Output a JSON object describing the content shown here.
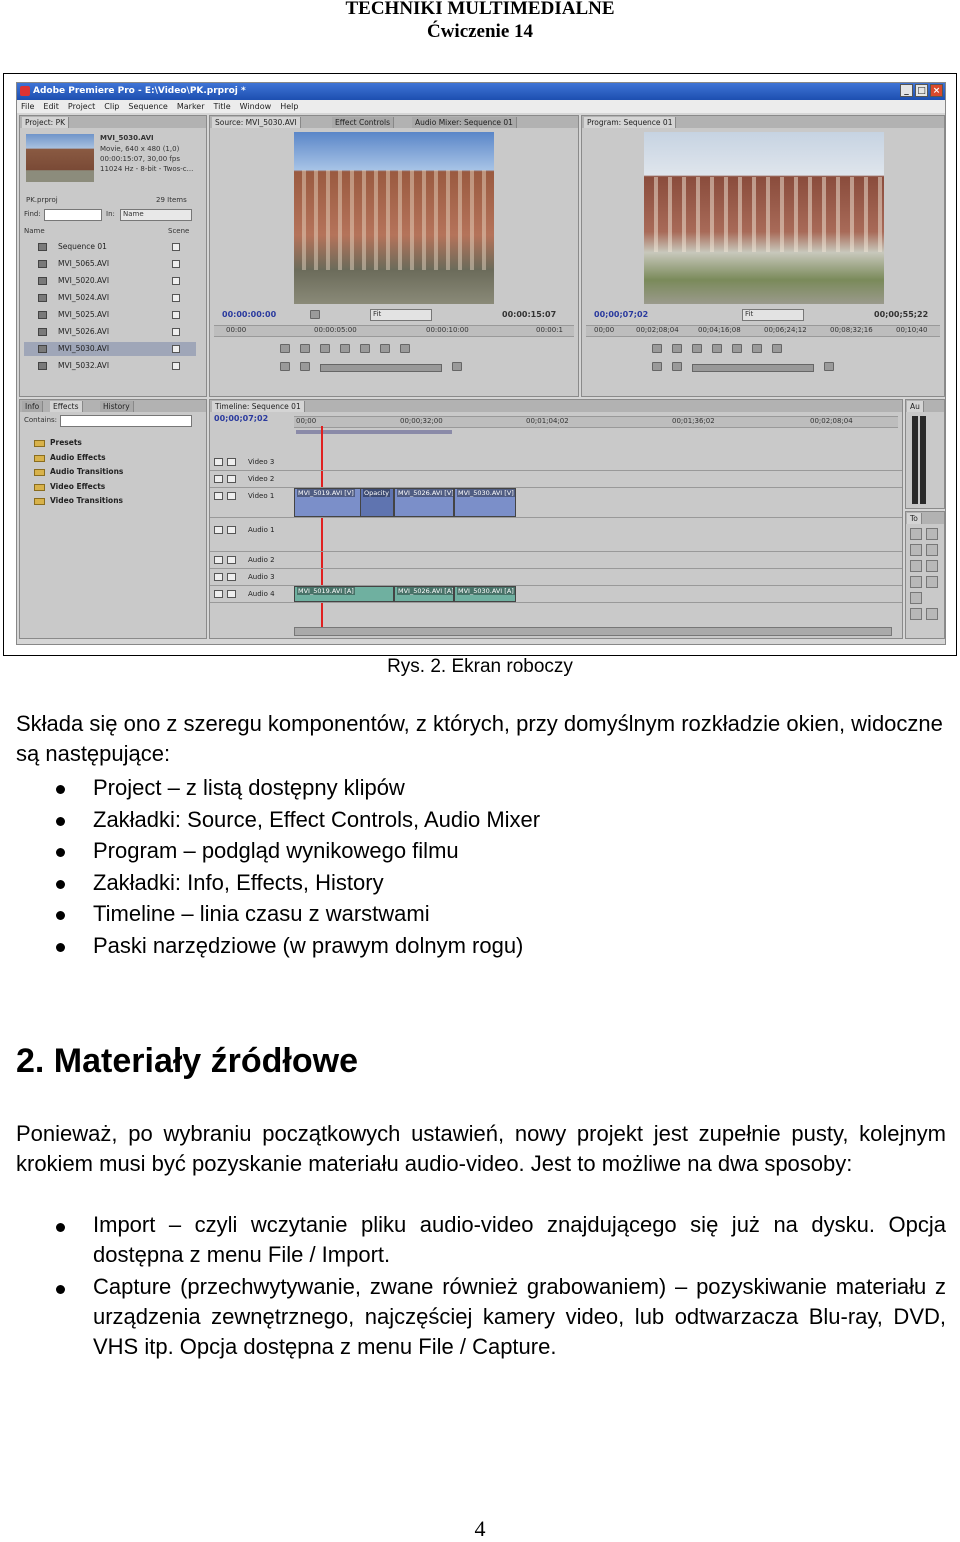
{
  "header": {
    "course": "TECHNIKI MULTIMEDIALNE",
    "exercise": "Ćwiczenie 14"
  },
  "screenshot": {
    "window_title": "Adobe Premiere Pro - E:\\Video\\PK.prproj *",
    "window_buttons": [
      "_",
      "□",
      "×"
    ],
    "menu": [
      "File",
      "Edit",
      "Project",
      "Clip",
      "Sequence",
      "Marker",
      "Title",
      "Window",
      "Help"
    ],
    "project_panel": {
      "tab": "Project: PK",
      "clip_name": "MVI_5030.AVI",
      "clip_info": [
        "Movie, 640 x 480 (1,0)",
        "00:00:15:07, 30,00 fps",
        "11024 Hz - 8-bit - Twos-c..."
      ],
      "project_file": "PK.prproj",
      "item_count": "29 Items",
      "find_label": "Find:",
      "in_label": "In:",
      "in_value": "Name",
      "col_name": "Name",
      "col_scene": "Scene",
      "items": [
        "Sequence 01",
        "MVI_5065.AVI",
        "MVI_5020.AVI",
        "MVI_5024.AVI",
        "MVI_5025.AVI",
        "MVI_5026.AVI",
        "MVI_5030.AVI",
        "MVI_5032.AVI"
      ],
      "selected_index": 6
    },
    "source_panel": {
      "tabs": [
        "Source: MVI_5030.AVI",
        "Effect Controls",
        "Audio Mixer: Sequence 01"
      ],
      "timecode_left": "00:00:00:00",
      "fit": "Fit",
      "timecode_right": "00:00:15:07",
      "ruler": [
        "00:00",
        "00:00:05:00",
        "00:00:10:00",
        "00:00:1"
      ]
    },
    "program_panel": {
      "tab": "Program: Sequence 01",
      "timecode_left": "00;00;07;02",
      "fit": "Fit",
      "timecode_right": "00;00;55;22",
      "ruler": [
        "00;00",
        "00;02;08;04",
        "00;04;16;08",
        "00;06;24;12",
        "00;08;32;16",
        "00;10;40"
      ]
    },
    "effects_panel": {
      "tabs": [
        "Info",
        "Effects",
        "History"
      ],
      "contains_label": "Contains:",
      "folders": [
        "Presets",
        "Audio Effects",
        "Audio Transitions",
        "Video Effects",
        "Video Transitions"
      ]
    },
    "timeline_panel": {
      "tab": "Timeline: Sequence 01",
      "timecode": "00;00;07;02",
      "ruler": [
        "00;00",
        "00;00;32;00",
        "00;01;04;02",
        "00;01;36;02",
        "00;02;08;04"
      ],
      "video_tracks": [
        "Video 3",
        "Video 2",
        "Video 1"
      ],
      "audio_tracks": [
        "Audio 1",
        "Audio 2",
        "Audio 3",
        "Audio 4"
      ],
      "video_clips": [
        "MVI_5019.AVI [V]",
        "Opacity",
        "MVI_5026.AVI [V]",
        "MVI_5030.AVI [V]"
      ],
      "audio_clips": [
        "MVI_5019.AVI [A]",
        "MVI_5026.AVI [A]",
        "MVI_5030.AVI [A]"
      ]
    },
    "audio_meter_tab": "Au",
    "tools_tab": "To"
  },
  "caption": "Rys. 2. Ekran roboczy",
  "intro": "Składa się ono z szeregu komponentów, z których, przy domyślnym rozkładzie okien, widoczne są następujące:",
  "components": [
    "Project – z listą dostępny klipów",
    "Zakładki: Source, Effect Controls, Audio Mixer",
    "Program – podgląd wynikowego filmu",
    "Zakładki: Info, Effects, History",
    "Timeline – linia czasu z warstwami",
    "Paski narzędziowe (w prawym dolnym rogu)"
  ],
  "section_title": "2. Materiały źródłowe",
  "section_intro": "Ponieważ, po wybraniu początkowych ustawień, nowy projekt jest zupełnie pusty, kolejnym krokiem musi być pozyskanie materiału audio-video. Jest to możliwe na dwa sposoby:",
  "methods": [
    "Import – czyli wczytanie pliku audio-video znajdującego się już na dysku. Opcja dostępna z menu File / Import.",
    "Capture (przechwytywanie, zwane również grabowaniem) – pozyskiwanie materiału z urządzenia zewnętrznego, najczęściej kamery video, lub odtwarzacza Blu-ray, DVD, VHS itp. Opcja dostępna z menu File / Capture."
  ],
  "page_number": "4"
}
